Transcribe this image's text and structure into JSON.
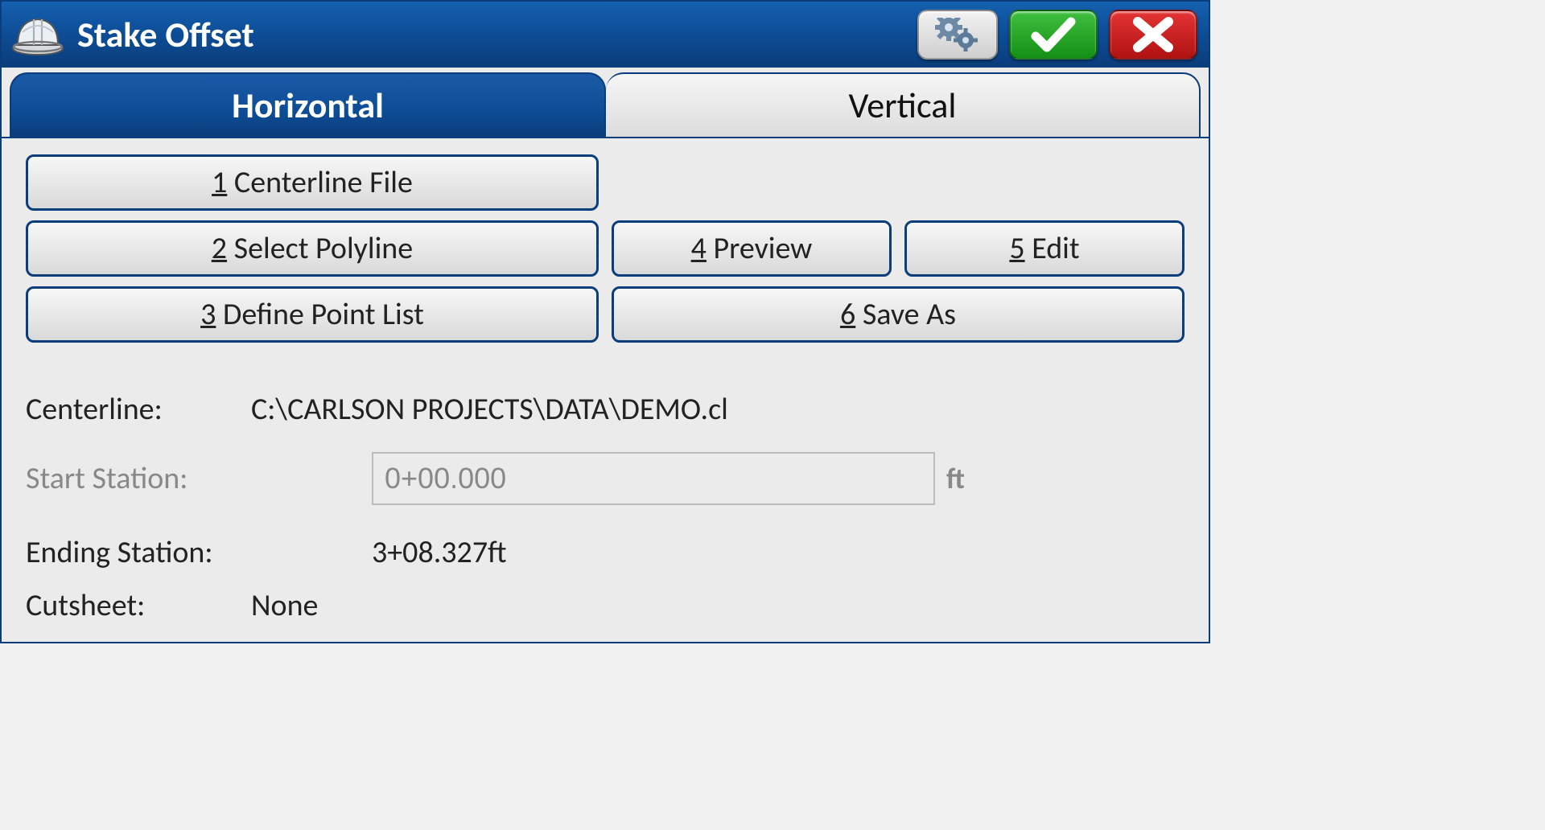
{
  "header": {
    "title": "Stake Offset"
  },
  "tabs": {
    "horizontal": "Horizontal",
    "vertical": "Vertical"
  },
  "buttons": {
    "centerline_file": {
      "num": "1",
      "label": " Centerline File"
    },
    "select_polyline": {
      "num": "2",
      "label": " Select Polyline"
    },
    "define_point_list": {
      "num": "3",
      "label": " Define Point List"
    },
    "preview": {
      "num": "4",
      "label": " Preview"
    },
    "edit": {
      "num": "5",
      "label": " Edit"
    },
    "save_as": {
      "num": "6",
      "label": " Save As"
    }
  },
  "info": {
    "centerline_label": "Centerline:",
    "centerline_value": "C:\\CARLSON PROJECTS\\DATA\\DEMO.cl",
    "start_station_label": "Start Station:",
    "start_station_value": "0+00.000",
    "start_station_unit": "ft",
    "ending_station_label": "Ending Station:",
    "ending_station_value": "3+08.327ft",
    "cutsheet_label": "Cutsheet:",
    "cutsheet_value": "None"
  }
}
